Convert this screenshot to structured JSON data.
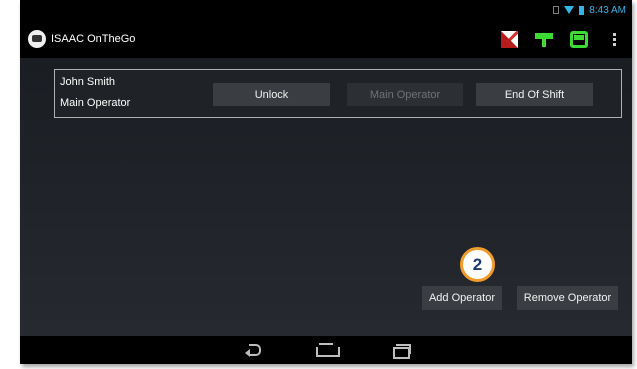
{
  "status_bar": {
    "time": "8:43 AM"
  },
  "action_bar": {
    "title": "ISAAC OnTheGo",
    "icons": [
      "app-logo-icon",
      "flag-icon",
      "signpost-icon",
      "bus-icon",
      "overflow-menu-icon"
    ]
  },
  "operator": {
    "name": "John Smith",
    "role": "Main Operator",
    "unlock_label": "Unlock",
    "main_operator_label": "Main Operator",
    "end_of_shift_label": "End Of Shift"
  },
  "footer_actions": {
    "add_label": "Add Operator",
    "remove_label": "Remove Operator"
  },
  "callout": {
    "number": "2"
  },
  "nav_bar": {
    "icons": [
      "back-icon",
      "home-icon",
      "recent-apps-icon"
    ]
  },
  "colors": {
    "accent_green": "#3ddc34",
    "status_blue": "#33b5e5",
    "callout_orange": "#f39c2b",
    "callout_text": "#1d3b6e"
  }
}
